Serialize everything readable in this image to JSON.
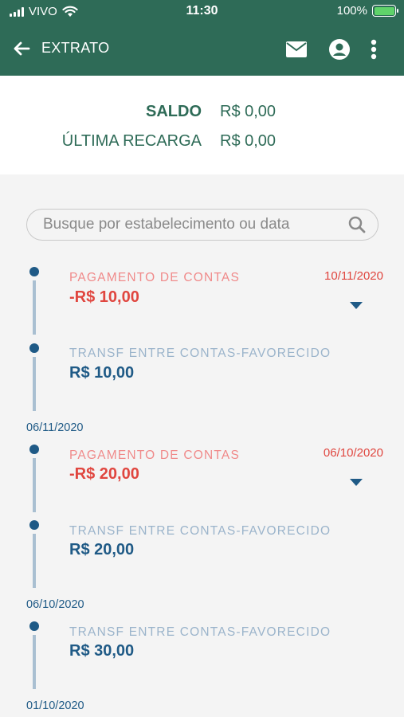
{
  "status": {
    "carrier": "VIVO",
    "time": "11:30",
    "battery": "100%"
  },
  "appbar": {
    "title": "EXTRATO"
  },
  "balance": {
    "saldo_label": "SALDO",
    "saldo_value": "R$ 0,00",
    "recarga_label": "ÚLTIMA RECARGA",
    "recarga_value": "R$ 0,00"
  },
  "search": {
    "placeholder": "Busque por estabelecimento ou data"
  },
  "transactions": [
    {
      "label": "PAGAMENTO DE CONTAS",
      "amount": "-R$ 10,00",
      "date": "10/11/2020"
    },
    {
      "label": "TRANSF ENTRE CONTAS-FAVORECIDO",
      "amount": "R$ 10,00"
    },
    {
      "label": "PAGAMENTO DE CONTAS",
      "amount": "-R$ 20,00",
      "date": "06/10/2020"
    },
    {
      "label": "TRANSF ENTRE CONTAS-FAVORECIDO",
      "amount": "R$ 20,00"
    },
    {
      "label": "TRANSF ENTRE CONTAS-FAVORECIDO",
      "amount": "R$ 30,00"
    }
  ],
  "group_dates": [
    "06/11/2020",
    "06/10/2020",
    "01/10/2020"
  ],
  "colors": {
    "header": "#2e6b57",
    "debit": "#e0463f",
    "credit": "#1f5a86"
  }
}
